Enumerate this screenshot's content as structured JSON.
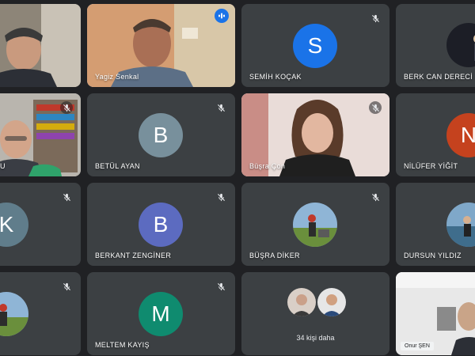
{
  "participants": [
    {
      "name": "",
      "avatar_letter": "",
      "color": "",
      "muted": false,
      "speaking": false
    },
    {
      "name": "Yagiz Senkal",
      "avatar_letter": "",
      "color": "",
      "muted": false,
      "speaking": true
    },
    {
      "name": "SEMİH KOÇAK",
      "avatar_letter": "S",
      "color": "#1a73e8",
      "muted": true,
      "speaking": false
    },
    {
      "name": "BERK CAN DERECİ",
      "avatar_letter": "",
      "color": "",
      "muted": false,
      "speaking": false
    },
    {
      "name": "U",
      "avatar_letter": "",
      "color": "",
      "muted": true,
      "speaking": false
    },
    {
      "name": "BETÜL AYAN",
      "avatar_letter": "B",
      "color": "#78909c",
      "muted": true,
      "speaking": false
    },
    {
      "name": "Büşra Çon",
      "avatar_letter": "",
      "color": "",
      "muted": true,
      "speaking": false
    },
    {
      "name": "NİLÜFER YİĞİT",
      "avatar_letter": "N",
      "color": "#c5421e",
      "muted": false,
      "speaking": false
    },
    {
      "name": "",
      "avatar_letter": "K",
      "color": "#607d8b",
      "muted": true,
      "speaking": false
    },
    {
      "name": "BERKANT ZENGİNER",
      "avatar_letter": "B",
      "color": "#5c6bc0",
      "muted": true,
      "speaking": false
    },
    {
      "name": "BÜŞRA DİKER",
      "avatar_letter": "",
      "color": "",
      "muted": true,
      "speaking": false
    },
    {
      "name": "DURSUN YILDIZ",
      "avatar_letter": "",
      "color": "",
      "muted": false,
      "speaking": false
    },
    {
      "name": "",
      "avatar_letter": "",
      "color": "",
      "muted": true,
      "speaking": false
    },
    {
      "name": "MELTEM KAYIŞ",
      "avatar_letter": "M",
      "color": "#0f8b6f",
      "muted": true,
      "speaking": false
    },
    {
      "name": "34 kişi daha",
      "avatar_letter": "",
      "color": "",
      "muted": false,
      "speaking": false
    },
    {
      "name": "Onur ŞEN",
      "avatar_letter": "",
      "color": "",
      "muted": false,
      "speaking": false
    }
  ]
}
